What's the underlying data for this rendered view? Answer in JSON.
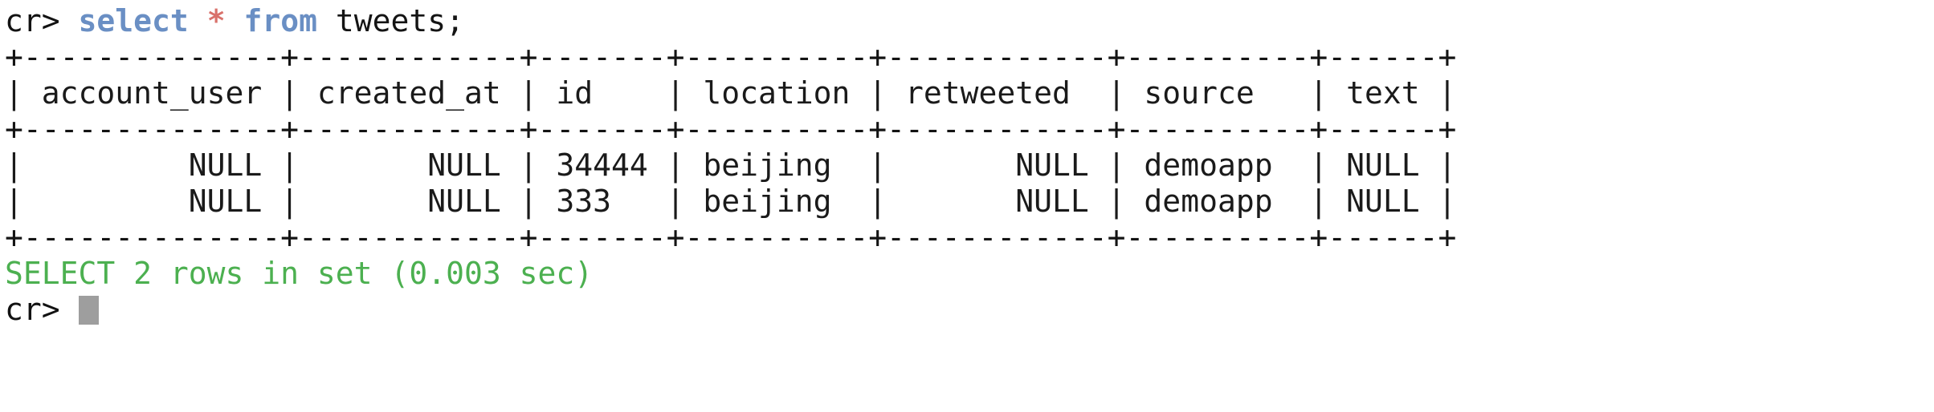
{
  "terminal": {
    "app": "crash (CrateDB shell)",
    "prompt_symbol": "cr>",
    "colors": {
      "background": "#ffffff",
      "foreground": "#141414",
      "keyword": "#6a8fc4",
      "operator": "#d9716b",
      "success": "#4cb050",
      "cursor": "#9e9e9e"
    }
  },
  "command_line": {
    "prompt": "cr> ",
    "keyword_select": "select",
    "star": "*",
    "keyword_from": "from",
    "table": "tweets;",
    "full_text": "cr> select * from tweets;"
  },
  "result_table": {
    "top_rule": "+--------------+------------+-------+----------+------------+----------+------+",
    "header_row": "| account_user | created_at | id    | location | retweeted  | source   | text |",
    "mid_rule": "+--------------+------------+-------+----------+------------+----------+------+",
    "bottom_rule": "+--------------+------------+-------+----------+------------+----------+------+",
    "columns": [
      "account_user",
      "created_at",
      "id",
      "location",
      "retweeted",
      "source",
      "text"
    ],
    "rows": [
      {
        "line": "|         NULL |       NULL | 34444 | beijing  |       NULL | demoapp  | NULL |",
        "account_user": "NULL",
        "created_at": "NULL",
        "id": "34444",
        "location": "beijing",
        "retweeted": "NULL",
        "source": "demoapp",
        "text": "NULL"
      },
      {
        "line": "|         NULL |       NULL | 333   | beijing  |       NULL | demoapp  | NULL |",
        "account_user": "NULL",
        "created_at": "NULL",
        "id": "333",
        "location": "beijing",
        "retweeted": "NULL",
        "source": "demoapp",
        "text": "NULL"
      }
    ]
  },
  "status_line": {
    "text": "SELECT 2 rows in set (0.003 sec)",
    "statement": "SELECT",
    "row_count": "2",
    "duration_sec": "0.003"
  },
  "final_prompt": {
    "prompt": "cr> ",
    "input_value": ""
  }
}
